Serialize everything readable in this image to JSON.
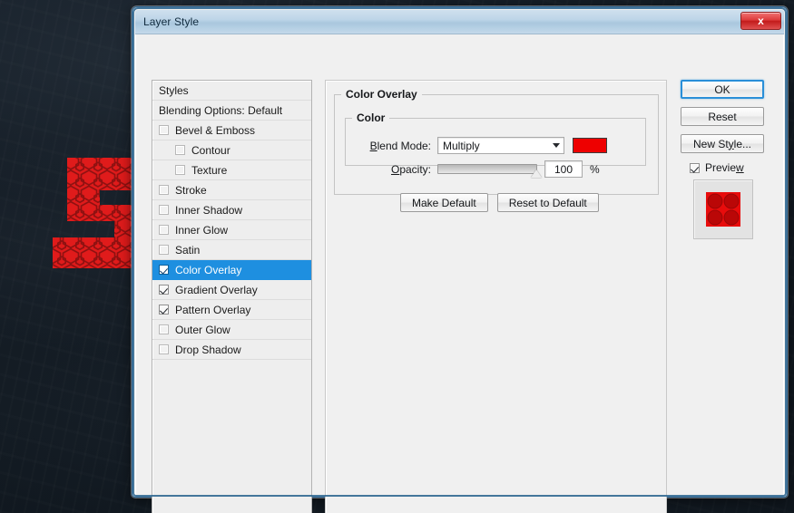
{
  "window": {
    "title": "Layer Style",
    "close_label": "x"
  },
  "styles_panel": {
    "header": "Styles",
    "blending_options": "Blending Options: Default",
    "items": [
      {
        "label": "Bevel & Emboss",
        "checked": false,
        "indent": false,
        "selected": false
      },
      {
        "label": "Contour",
        "checked": false,
        "indent": true,
        "selected": false
      },
      {
        "label": "Texture",
        "checked": false,
        "indent": true,
        "selected": false
      },
      {
        "label": "Stroke",
        "checked": false,
        "indent": false,
        "selected": false
      },
      {
        "label": "Inner Shadow",
        "checked": false,
        "indent": false,
        "selected": false
      },
      {
        "label": "Inner Glow",
        "checked": false,
        "indent": false,
        "selected": false
      },
      {
        "label": "Satin",
        "checked": false,
        "indent": false,
        "selected": false
      },
      {
        "label": "Color Overlay",
        "checked": true,
        "indent": false,
        "selected": true
      },
      {
        "label": "Gradient Overlay",
        "checked": true,
        "indent": false,
        "selected": false
      },
      {
        "label": "Pattern Overlay",
        "checked": true,
        "indent": false,
        "selected": false
      },
      {
        "label": "Outer Glow",
        "checked": false,
        "indent": false,
        "selected": false
      },
      {
        "label": "Drop Shadow",
        "checked": false,
        "indent": false,
        "selected": false
      }
    ]
  },
  "settings": {
    "group_title": "Color Overlay",
    "color_group_title": "Color",
    "blend_mode_label": "Blend Mode:",
    "blend_mode_label_pre": "B",
    "blend_mode_label_accel": "l",
    "blend_mode_label_post": "end Mode:",
    "blend_mode_value": "Multiply",
    "color_swatch_hex": "#ee0000",
    "opacity_label_pre": "",
    "opacity_label_accel": "O",
    "opacity_label_post": "pacity:",
    "opacity_value": "100",
    "opacity_unit": "%",
    "opacity_percent": 100,
    "make_default_label": "Make Default",
    "reset_to_default_label": "Reset to Default"
  },
  "right_buttons": {
    "ok_label": "OK",
    "reset_label": "Reset",
    "new_style_pre": "New St",
    "new_style_accel": "y",
    "new_style_post": "le...",
    "new_style_label": "New Style...",
    "preview_label_pre": "Previe",
    "preview_label_accel": "w",
    "preview_label": "Preview",
    "preview_checked": true
  },
  "desktop": {
    "letter": "S",
    "letter_color": "#e01b1b",
    "letter_pattern": "hexagon-honeycomb",
    "background_color": "#121a22"
  }
}
